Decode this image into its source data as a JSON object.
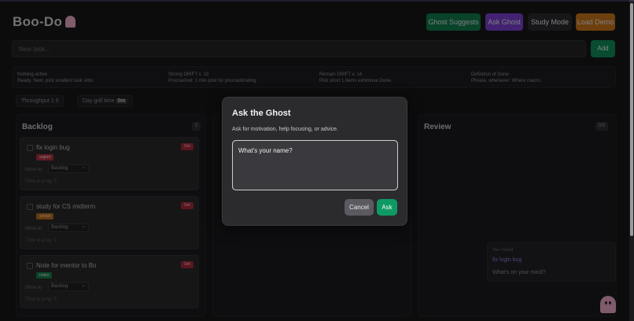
{
  "app": {
    "title": "Boo-Do"
  },
  "header": {
    "buttons": [
      {
        "label": "Ghost Suggests",
        "color": "#0f7a4e"
      },
      {
        "label": "Ask Ghost",
        "color": "#7a3fd0"
      },
      {
        "label": "Study Mode",
        "color": "#2a2a2e"
      },
      {
        "label": "Load Demo",
        "color": "#c9731a"
      }
    ]
  },
  "task_input": {
    "placeholder": "New task...",
    "add_label": "Add"
  },
  "info_row": [
    {
      "line1": "Nothing active",
      "line2": "Ready. Next, pick smallest task unto."
    },
    {
      "line1": "Strong DRIFT v. 13",
      "line2": "Procrastnot: 1 min post for procrastinating."
    },
    {
      "line1": "Remain DRIFT v. 14",
      "line2": "Pick short 1 items exhimuse Done."
    },
    {
      "line1": "Definition of Done",
      "line2": "Phrase, whenever: Where macro."
    }
  ],
  "pills": [
    {
      "label": "Throughput 1 0",
      "value": "0"
    },
    {
      "label": "Day grill time",
      "value": "0m"
    }
  ],
  "columns": [
    {
      "title": "Backlog",
      "count": "3"
    },
    {
      "title": "",
      "count": ""
    },
    {
      "title": "Review",
      "count": "0/3"
    }
  ],
  "cards": [
    {
      "title": "fix login bug",
      "tag": "urgent",
      "tag_color": "#b0303f",
      "delete": "Del",
      "move_label": "Move to",
      "move_value": "Backlog",
      "time": "Time in prog: 0"
    },
    {
      "title": "study for CS midterm",
      "tag": "school",
      "tag_color": "#b76a1a",
      "delete": "Del",
      "move_label": "Move to",
      "move_value": "Backlog",
      "time": "Time in prog: 0"
    },
    {
      "title": "Note for mentor to Bo",
      "tag": "notes",
      "tag_color": "#16804f",
      "delete": "Del",
      "move_label": "Move to",
      "move_value": "Backlog",
      "time": "Time in prog: 0"
    }
  ],
  "ghost_panel": {
    "head": "You • Ghost",
    "task": "fix login bug",
    "question": "What's on your mind?"
  },
  "modal": {
    "title": "Ask the Ghost",
    "description": "Ask for motivation, help focusing, or advice.",
    "input_value": "What's your name?",
    "cancel_label": "Cancel",
    "ask_label": "Ask"
  }
}
